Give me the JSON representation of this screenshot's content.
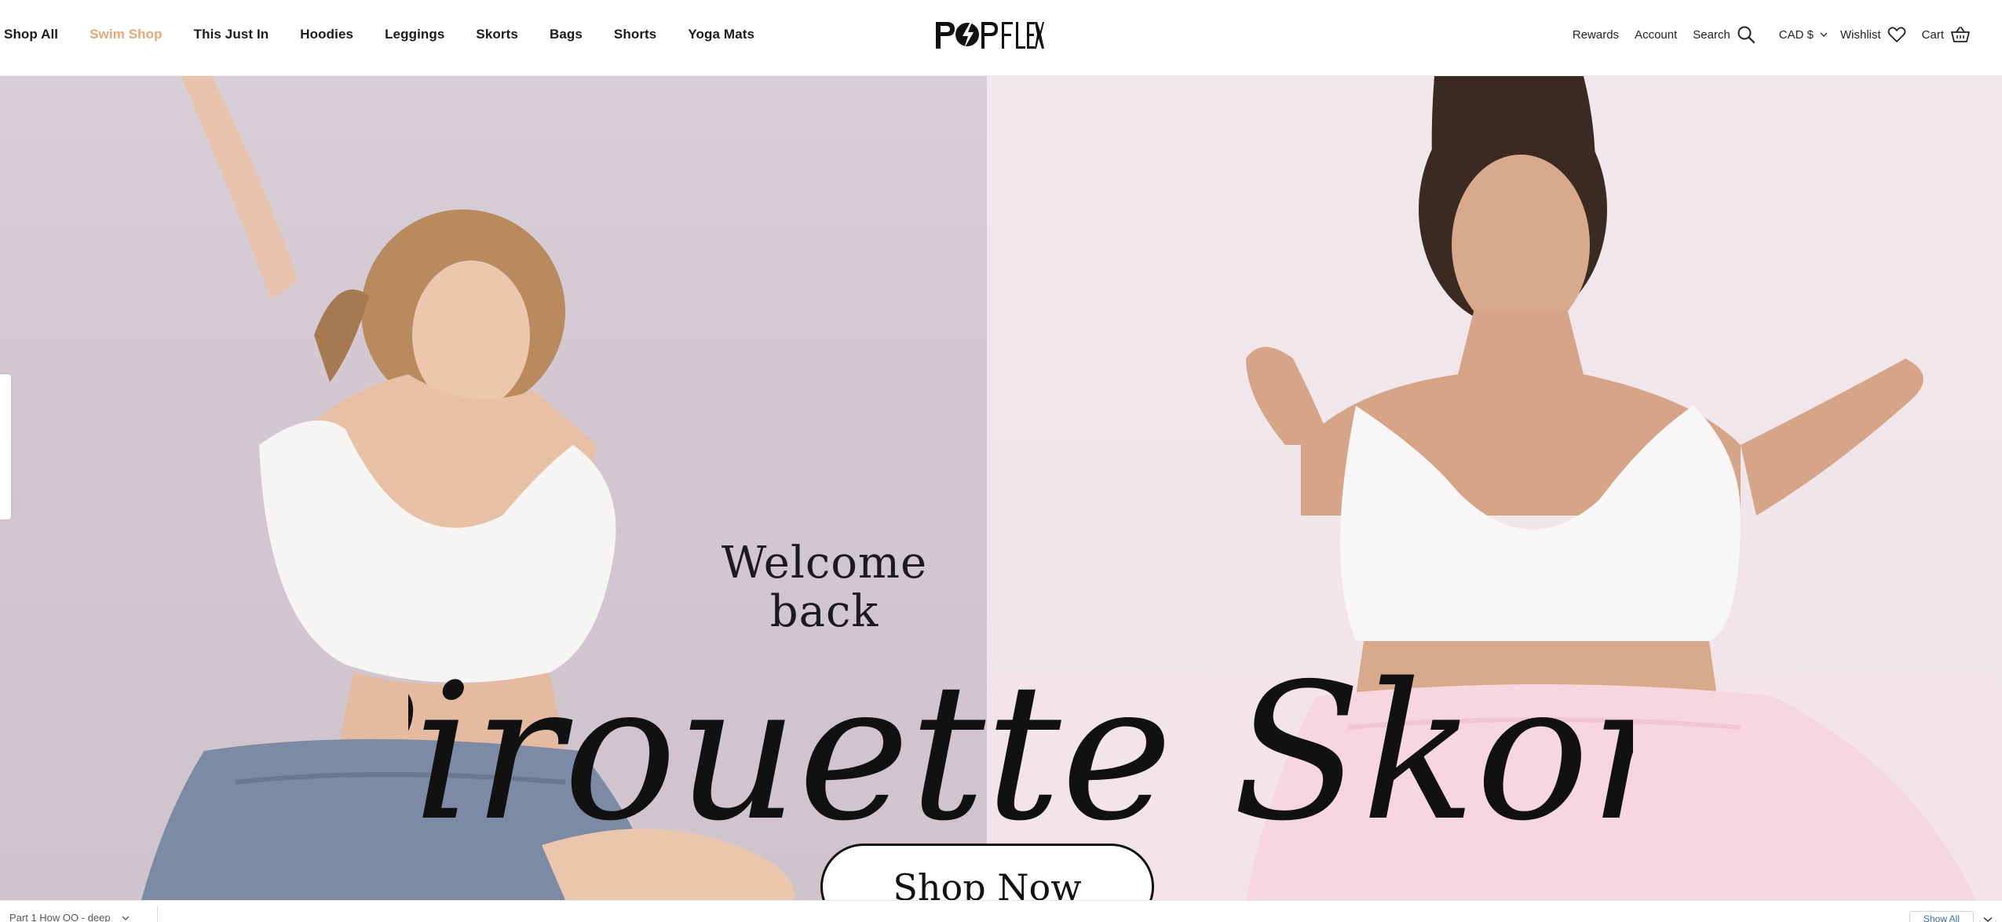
{
  "header": {
    "nav": [
      {
        "label": "Shop All",
        "accent": false
      },
      {
        "label": "Swim Shop",
        "accent": true
      },
      {
        "label": "This Just In",
        "accent": false
      },
      {
        "label": "Hoodies",
        "accent": false
      },
      {
        "label": "Leggings",
        "accent": false
      },
      {
        "label": "Skorts",
        "accent": false
      },
      {
        "label": "Bags",
        "accent": false
      },
      {
        "label": "Shorts",
        "accent": false
      },
      {
        "label": "Yoga Mats",
        "accent": false
      }
    ],
    "logo_text": "POPFLEX",
    "utilities": {
      "rewards": "Rewards",
      "account": "Account",
      "search": "Search",
      "currency": "CAD $",
      "wishlist": "Wishlist",
      "cart": "Cart"
    },
    "accent_color": "#e3a777"
  },
  "hero": {
    "welcome_line1": "Welcome",
    "welcome_line2": "back",
    "script_title": "Pirouette Skort",
    "cta_label": "Shop Now"
  },
  "bottom_bar": {
    "left_text": "Part 1 How OO - deep",
    "show_all_label": "Show All"
  },
  "icons": {
    "search": "search-icon",
    "currency_chevron": "chevron-down-icon",
    "wishlist": "heart-icon",
    "cart": "cart-icon"
  }
}
